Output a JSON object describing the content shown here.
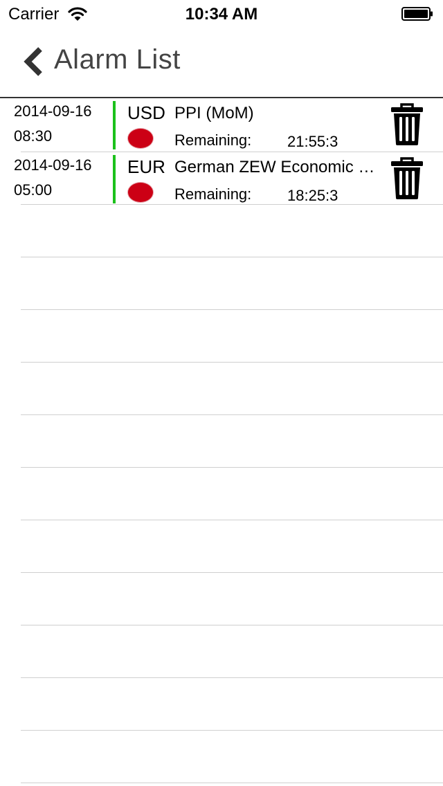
{
  "status_bar": {
    "carrier": "Carrier",
    "time": "10:34 AM"
  },
  "nav": {
    "title": "Alarm List",
    "back_icon": "chevron-left-icon"
  },
  "alarms": [
    {
      "date": "2014-09-16",
      "time": "08:30",
      "currency": "USD",
      "event": "PPI (MoM)",
      "remaining_label": "Remaining:",
      "remaining": "21:55:3"
    },
    {
      "date": "2014-09-16",
      "time": "05:00",
      "currency": "EUR",
      "event": "German ZEW Economic Sentiment",
      "remaining_label": "Remaining:",
      "remaining": "18:25:3"
    }
  ],
  "colors": {
    "impact_dot": "#cc0015",
    "row_indicator": "#1cc11c",
    "separator": "#cfcfcf"
  }
}
